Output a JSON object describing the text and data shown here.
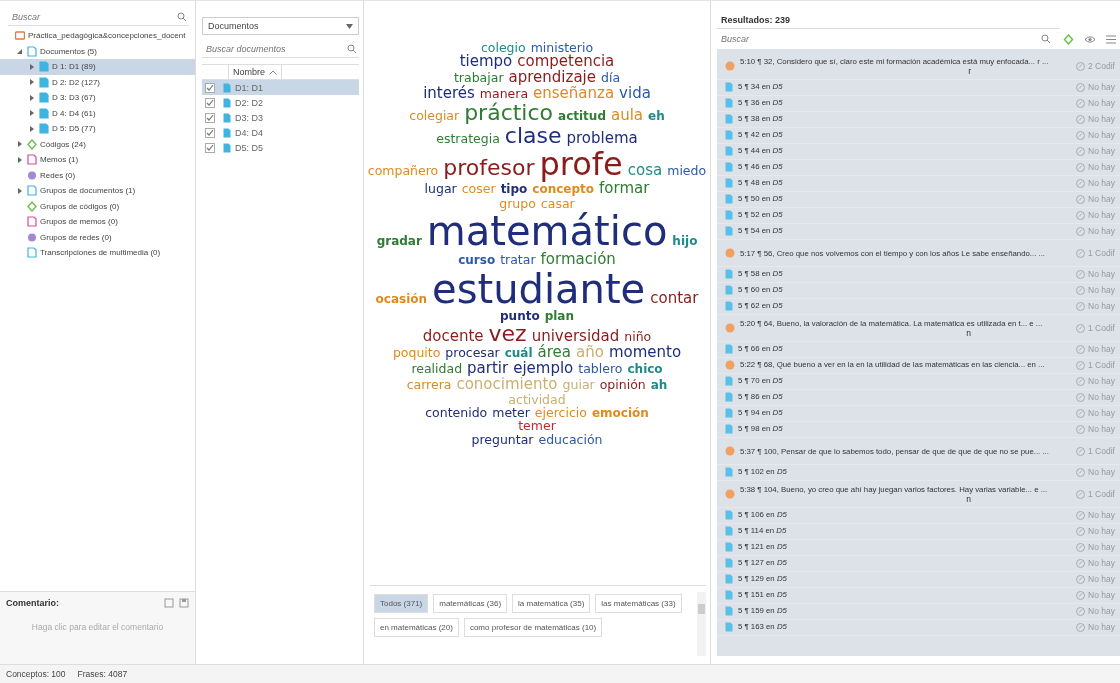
{
  "navigator": {
    "search": {
      "placeholder": "Buscar"
    },
    "tree": [
      {
        "label": "Práctica_pedagógica&concepciones_docent",
        "kind": "project",
        "selected": false,
        "children": [
          {
            "label": "Documentos (5)",
            "kind": "docs",
            "selected": false,
            "expanded": true,
            "children": [
              {
                "label": "D 1: D1 (89)",
                "kind": "doc",
                "selected": true,
                "expanded": false
              },
              {
                "label": "D 2: D2 (127)",
                "kind": "doc",
                "selected": false,
                "expanded": false
              },
              {
                "label": "D 3: D3 (67)",
                "kind": "doc",
                "selected": false,
                "expanded": false
              },
              {
                "label": "D 4: D4 (61)",
                "kind": "doc",
                "selected": false,
                "expanded": false
              },
              {
                "label": "D 5: D5 (77)",
                "kind": "doc",
                "selected": false,
                "expanded": false
              }
            ]
          },
          {
            "label": "Códigos (24)",
            "kind": "codes",
            "selected": false,
            "expanded": false
          },
          {
            "label": "Memos (1)",
            "kind": "memos",
            "selected": false,
            "expanded": false
          },
          {
            "label": "Redes (0)",
            "kind": "networks",
            "selected": false
          },
          {
            "label": "Grupos de documentos (1)",
            "kind": "docs",
            "selected": false,
            "expanded": false
          },
          {
            "label": "Grupos de códigos (0)",
            "kind": "codes",
            "selected": false
          },
          {
            "label": "Grupos de memos (0)",
            "kind": "memos",
            "selected": false
          },
          {
            "label": "Grupos de redes (0)",
            "kind": "networks",
            "selected": false
          },
          {
            "label": "Transcripciones de multimedia (0)",
            "kind": "docs",
            "selected": false
          }
        ]
      }
    ],
    "comment": {
      "title": "Comentario:",
      "placeholder": "Haga clic para editar el comentario"
    }
  },
  "documents": {
    "dropdown": "Documentos",
    "search": {
      "placeholder": "Buscar documentos"
    },
    "column": "Nombre",
    "rows": [
      {
        "name": "D1: D1",
        "checked": true,
        "selected": true
      },
      {
        "name": "D2: D2",
        "checked": true,
        "selected": false
      },
      {
        "name": "D3: D3",
        "checked": true,
        "selected": false
      },
      {
        "name": "D4: D4",
        "checked": true,
        "selected": false
      },
      {
        "name": "D5: D5",
        "checked": true,
        "selected": false
      }
    ]
  },
  "cloud": {
    "rows": [
      [
        {
          "text": "colegio",
          "kind": "s",
          "color": "#1f8a8a"
        },
        {
          "text": "ministerio",
          "kind": "s",
          "color": "#2a5aa8"
        }
      ],
      [
        {
          "text": "tiempo",
          "kind": "m",
          "color": "#1f2d7a"
        },
        {
          "text": "competencia",
          "kind": "m",
          "color": "#8a1c1c"
        }
      ],
      [
        {
          "text": "trabajar",
          "kind": "s",
          "color": "#2e7d32"
        },
        {
          "text": "aprendizaje",
          "kind": "m",
          "color": "#8a1c1c"
        },
        {
          "text": "día",
          "kind": "s",
          "color": "#2a5aa8"
        }
      ],
      [
        {
          "text": "interés",
          "kind": "m",
          "color": "#1f2d7a"
        },
        {
          "text": "manera",
          "kind": "s",
          "color": "#8a1c1c"
        },
        {
          "text": "enseñanza",
          "kind": "m",
          "color": "#e08a1e"
        },
        {
          "text": "vida",
          "kind": "m",
          "color": "#2a5aa8"
        }
      ],
      [
        {
          "text": "colegiar",
          "kind": "s",
          "color": "#e08a1e"
        },
        {
          "text": "práctico",
          "kind": "l",
          "color": "#2e7d32"
        },
        {
          "text": "actitud",
          "kind": "xs",
          "color": "#2e7d32"
        },
        {
          "text": "aula",
          "kind": "m",
          "color": "#e08a1e"
        },
        {
          "text": "eh",
          "kind": "xs",
          "color": "#1f8a8a"
        }
      ],
      [
        {
          "text": "estrategia",
          "kind": "s",
          "color": "#2e7d32"
        },
        {
          "text": "clase",
          "kind": "l",
          "color": "#1f2d7a"
        },
        {
          "text": "problema",
          "kind": "m",
          "color": "#1f2d7a"
        }
      ],
      [
        {
          "text": "compañero",
          "kind": "s",
          "color": "#e08a1e"
        },
        {
          "text": "profesor",
          "kind": "l",
          "color": "#8a1c1c"
        },
        {
          "text": "profe",
          "kind": "xl",
          "color": "#8a1c1c"
        },
        {
          "text": "cosa",
          "kind": "m",
          "color": "#1f8a8a"
        },
        {
          "text": "miedo",
          "kind": "s",
          "color": "#2a5aa8"
        }
      ],
      [
        {
          "text": "lugar",
          "kind": "s",
          "color": "#1f2d7a"
        },
        {
          "text": "coser",
          "kind": "s",
          "color": "#e08a1e"
        },
        {
          "text": "tipo",
          "kind": "xs",
          "color": "#1f2d7a"
        },
        {
          "text": "concepto",
          "kind": "xs",
          "color": "#e08a1e"
        },
        {
          "text": "formar",
          "kind": "m",
          "color": "#2e7d32"
        }
      ],
      [
        {
          "text": "grupo",
          "kind": "s",
          "color": "#e08a1e"
        },
        {
          "text": "casar",
          "kind": "s",
          "color": "#e08a1e"
        }
      ],
      [
        {
          "text": "gradar",
          "kind": "xs",
          "color": "#2e7d32"
        },
        {
          "text": "matemático",
          "kind": "xxl",
          "color": "#1f2d7a"
        },
        {
          "text": "hijo",
          "kind": "xs",
          "color": "#1f8a8a"
        }
      ],
      [
        {
          "text": "curso",
          "kind": "xs",
          "color": "#2a5aa8"
        },
        {
          "text": "tratar",
          "kind": "s",
          "color": "#2a5aa8"
        },
        {
          "text": "formación",
          "kind": "m",
          "color": "#2e7d32"
        }
      ],
      [
        {
          "text": "ocasión",
          "kind": "xs",
          "color": "#e08a1e"
        },
        {
          "text": "estudiante",
          "kind": "xxl",
          "color": "#1f2d7a"
        },
        {
          "text": "contar",
          "kind": "m",
          "color": "#8a1c1c"
        }
      ],
      [
        {
          "text": "punto",
          "kind": "xs",
          "color": "#1f2d7a"
        },
        {
          "text": "plan",
          "kind": "xs",
          "color": "#2e7d32"
        }
      ],
      [
        {
          "text": "docente",
          "kind": "m",
          "color": "#8a1c1c"
        },
        {
          "text": "vez",
          "kind": "l",
          "color": "#8a1c1c"
        },
        {
          "text": "universidad",
          "kind": "m",
          "color": "#8a1c1c"
        },
        {
          "text": "niño",
          "kind": "s",
          "color": "#8a1c1c"
        }
      ],
      [
        {
          "text": "poquito",
          "kind": "s",
          "color": "#e08a1e"
        },
        {
          "text": "procesar",
          "kind": "s",
          "color": "#1f2d7a"
        },
        {
          "text": "cuál",
          "kind": "xs",
          "color": "#1f8a8a"
        },
        {
          "text": "área",
          "kind": "m",
          "color": "#2e7d32"
        },
        {
          "text": "año",
          "kind": "m",
          "color": "#c8b070"
        },
        {
          "text": "momento",
          "kind": "m",
          "color": "#1f2d7a"
        }
      ],
      [
        {
          "text": "realidad",
          "kind": "s",
          "color": "#2e7d32"
        },
        {
          "text": "partir",
          "kind": "m",
          "color": "#1f2d7a"
        },
        {
          "text": "ejemplo",
          "kind": "m",
          "color": "#1f2d7a"
        },
        {
          "text": "tablero",
          "kind": "s",
          "color": "#2a5aa8"
        },
        {
          "text": "chico",
          "kind": "xs",
          "color": "#1f8a8a"
        }
      ],
      [
        {
          "text": "carrera",
          "kind": "s",
          "color": "#e08a1e"
        },
        {
          "text": "conocimiento",
          "kind": "m",
          "color": "#c8b070"
        },
        {
          "text": "guiar",
          "kind": "s",
          "color": "#c8b070"
        },
        {
          "text": "opinión",
          "kind": "s",
          "color": "#8a1c1c"
        },
        {
          "text": "ah",
          "kind": "xs",
          "color": "#1f8a8a"
        }
      ],
      [
        {
          "text": "actividad",
          "kind": "s",
          "color": "#c8b070"
        }
      ],
      [
        {
          "text": "contenido",
          "kind": "s",
          "color": "#1f2d7a"
        },
        {
          "text": "meter",
          "kind": "s",
          "color": "#1f2d7a"
        },
        {
          "text": "ejercicio",
          "kind": "s",
          "color": "#e08a1e"
        },
        {
          "text": "emoción",
          "kind": "xs",
          "color": "#e08a1e"
        }
      ],
      [
        {
          "text": "temer",
          "kind": "s",
          "color": "#c62828"
        }
      ],
      [
        {
          "text": "preguntar",
          "kind": "s",
          "color": "#1f2d7a"
        },
        {
          "text": "educación",
          "kind": "s",
          "color": "#2a5aa8"
        }
      ]
    ],
    "phrases": [
      {
        "label": "Todos (371)",
        "selected": true
      },
      {
        "label": "matemáticas (36)",
        "selected": false
      },
      {
        "label": "la matemática (35)",
        "selected": false
      },
      {
        "label": "las matemáticas (33)",
        "selected": false
      },
      {
        "label": "en matemáticas (20)",
        "selected": false
      },
      {
        "label": "como profesor de matemáticas (10)",
        "selected": false
      }
    ]
  },
  "results": {
    "title": "Resultados: 239",
    "search": {
      "placeholder": "Buscar"
    },
    "rows": [
      {
        "kind": "quote",
        "text": "5:10 ¶ 32, Considero que sí, claro este mi formación académica está muy enfocada... r ...",
        "tail": "r",
        "codes": "2 Codif"
      },
      {
        "kind": "ref",
        "text": "5 ¶ 34 en *D5*",
        "codes": "No hay"
      },
      {
        "kind": "ref",
        "text": "5 ¶ 36 en *D5*",
        "codes": "No hay"
      },
      {
        "kind": "ref",
        "text": "5 ¶ 38 en *D5*",
        "codes": "No hay"
      },
      {
        "kind": "ref",
        "text": "5 ¶ 42 en *D5*",
        "codes": "No hay"
      },
      {
        "kind": "ref",
        "text": "5 ¶ 44 en *D5*",
        "codes": "No hay"
      },
      {
        "kind": "ref",
        "text": "5 ¶ 46 en *D5*",
        "codes": "No hay"
      },
      {
        "kind": "ref",
        "text": "5 ¶ 48 en *D5*",
        "codes": "No hay"
      },
      {
        "kind": "ref",
        "text": "5 ¶ 50 en *D5*",
        "codes": "No hay"
      },
      {
        "kind": "ref",
        "text": "5 ¶ 52 en *D5*",
        "codes": "No hay"
      },
      {
        "kind": "ref",
        "text": "5 ¶ 54 en *D5*",
        "codes": "No hay"
      },
      {
        "kind": "quote",
        "text": "5:17 ¶ 56, Creo que nos volvemos con el tiempo y con  los años Le sabe enseñando... ...",
        "codes": "1 Codif"
      },
      {
        "kind": "ref",
        "text": "5 ¶ 58 en *D5*",
        "codes": "No hay"
      },
      {
        "kind": "ref",
        "text": "5 ¶ 60 en *D5*",
        "codes": "No hay"
      },
      {
        "kind": "ref",
        "text": "5 ¶ 62 en *D5*",
        "codes": "No hay"
      },
      {
        "kind": "quote",
        "text": "5:20 ¶ 64, Bueno, la valoración de la matemática. La matemática es utilizada en t... e ...",
        "tail": "n",
        "codes": "1 Codif"
      },
      {
        "kind": "ref",
        "text": "5 ¶ 66 en *D5*",
        "codes": "No hay"
      },
      {
        "kind": "quote-short",
        "text": "5:22 ¶ 68, Qué bueno a ver en la en la utilidad de las matemáticas en las ciencia... en ...",
        "codes": "1 Codif"
      },
      {
        "kind": "ref",
        "text": "5 ¶ 70 en *D5*",
        "codes": "No hay"
      },
      {
        "kind": "ref",
        "text": "5 ¶ 86 en *D5*",
        "codes": "No hay"
      },
      {
        "kind": "ref",
        "text": "5 ¶ 94 en *D5*",
        "codes": "No hay"
      },
      {
        "kind": "ref",
        "text": "5 ¶ 98 en *D5*",
        "codes": "No hay"
      },
      {
        "kind": "quote",
        "text": "5:37 ¶ 100, Pensar de que lo sabemos todo, pensar de que de que de que no se pue... ...",
        "codes": "1 Codif"
      },
      {
        "kind": "ref",
        "text": "5 ¶ 102 en *D5*",
        "codes": "No hay"
      },
      {
        "kind": "quote",
        "text": "5:38 ¶ 104, Bueno, yo creo que ahí hay juegan varios factores. Hay varias variable... e ...",
        "tail": "n",
        "codes": "1 Codif"
      },
      {
        "kind": "ref",
        "text": "5 ¶ 106 en *D5*",
        "codes": "No hay"
      },
      {
        "kind": "ref",
        "text": "5 ¶ 114 en *D5*",
        "codes": "No hay"
      },
      {
        "kind": "ref",
        "text": "5 ¶ 121 en *D5*",
        "codes": "No hay"
      },
      {
        "kind": "ref",
        "text": "5 ¶ 127 en *D5*",
        "codes": "No hay"
      },
      {
        "kind": "ref",
        "text": "5 ¶ 129 en *D5*",
        "codes": "No hay"
      },
      {
        "kind": "ref",
        "text": "5 ¶ 151 en *D5*",
        "codes": "No hay"
      },
      {
        "kind": "ref",
        "text": "5 ¶ 159 en *D5*",
        "codes": "No hay"
      },
      {
        "kind": "ref",
        "text": "5 ¶ 163 en *D5*",
        "codes": "No hay"
      }
    ]
  },
  "status_bar": [
    "Conceptos: 100",
    "Frases: 4087"
  ]
}
